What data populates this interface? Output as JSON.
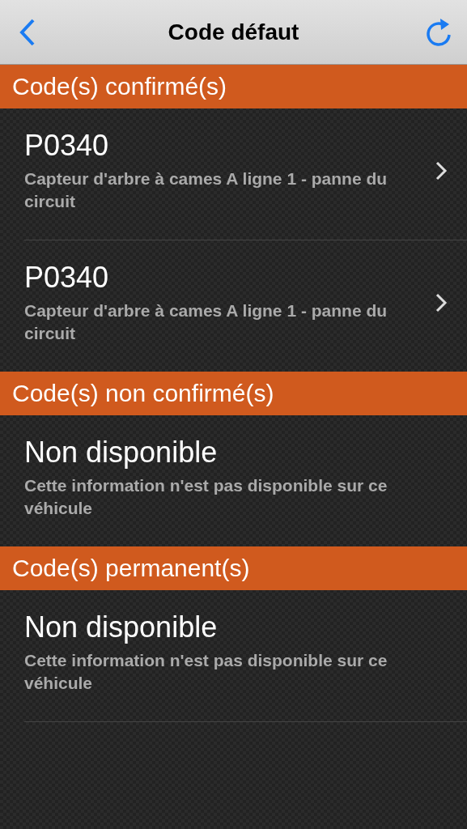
{
  "nav": {
    "title": "Code défaut"
  },
  "sections": [
    {
      "title": "Code(s) confirmé(s)",
      "items": [
        {
          "kind": "link",
          "code": "P0340",
          "description": "Capteur d'arbre à cames A ligne 1 - panne du circuit"
        },
        {
          "kind": "link",
          "code": "P0340",
          "description": "Capteur d'arbre à cames A ligne 1 - panne du circuit"
        }
      ]
    },
    {
      "title": "Code(s) non confirmé(s)",
      "items": [
        {
          "kind": "info",
          "code": "Non disponible",
          "description": "Cette information n'est pas disponible sur ce véhicule"
        }
      ]
    },
    {
      "title": "Code(s) permanent(s)",
      "items": [
        {
          "kind": "info",
          "code": "Non disponible",
          "description": "Cette information n'est pas disponible sur ce véhicule"
        }
      ]
    }
  ]
}
